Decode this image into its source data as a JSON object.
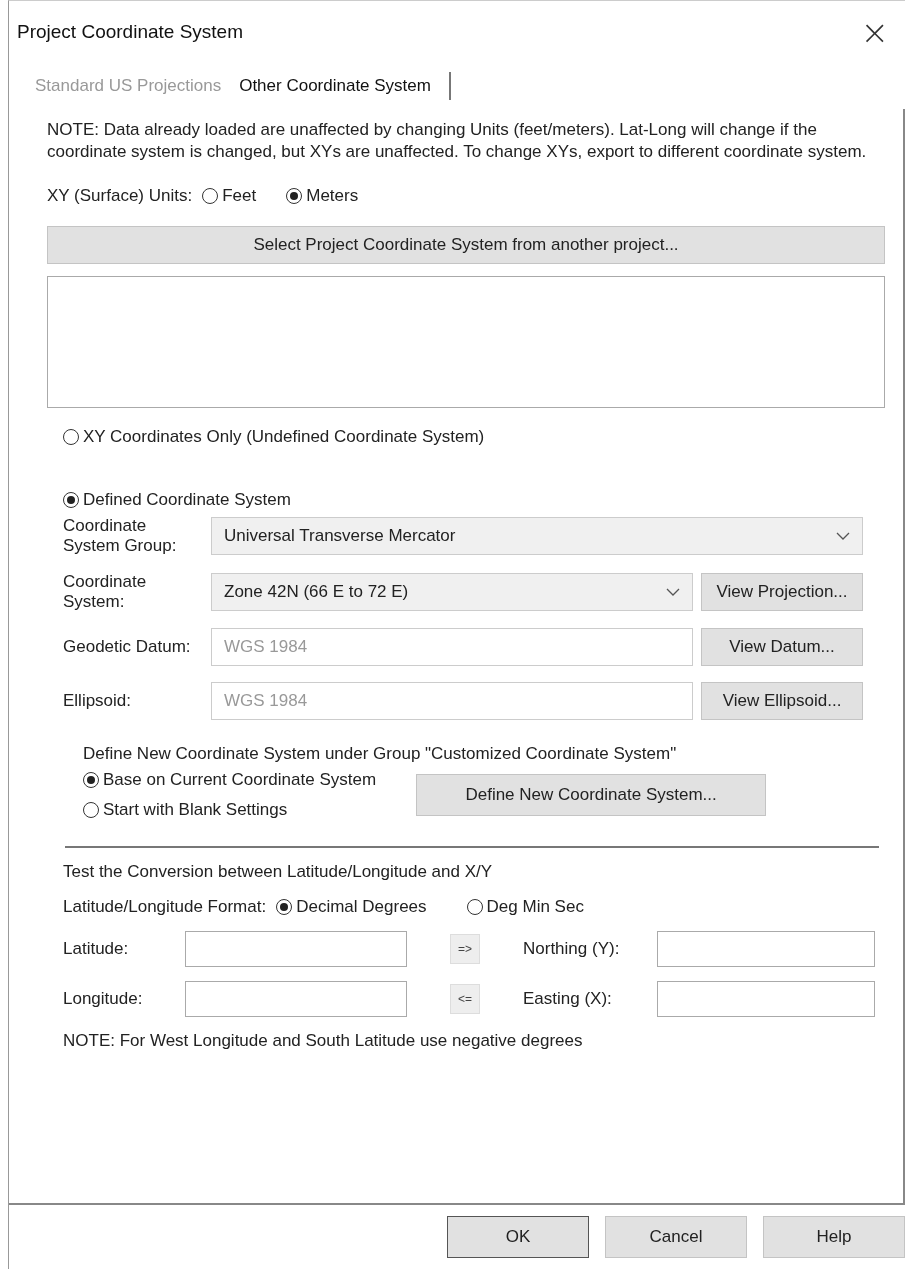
{
  "window": {
    "title": "Project Coordinate System",
    "close": "×"
  },
  "tabs": [
    {
      "label": "Standard US Projections",
      "selected": false
    },
    {
      "label": "Other Coordinate System",
      "selected": true
    }
  ],
  "note": "NOTE: Data already loaded are unaffected by changing Units (feet/meters). Lat-Long will change if the coordinate system is changed, but XYs are unaffected. To change XYs, export to different coordinate system.",
  "units": {
    "label": "XY (Surface) Units:",
    "options": [
      {
        "label": "Feet",
        "selected": false
      },
      {
        "label": "Meters",
        "selected": true
      }
    ]
  },
  "select_button": "Select Project Coordinate System from another project...",
  "system_mode": [
    {
      "label": "XY Coordinates Only (Undefined Coordinate System)",
      "selected": false
    },
    {
      "label": "Defined Coordinate System",
      "selected": true
    }
  ],
  "fields": [
    {
      "kind": "dropdown",
      "label": "Coordinate System Group:",
      "value": "Universal Transverse Mercator",
      "disabled": false
    },
    {
      "kind": "dropdown",
      "label": "Coordinate System:",
      "value": "Zone 42N (66 E to 72 E)",
      "disabled": false,
      "button": "View Projection..."
    },
    {
      "kind": "text",
      "label": "Geodetic Datum:",
      "value": "WGS 1984",
      "disabled": true,
      "button": "View Datum..."
    },
    {
      "kind": "text",
      "label": "Ellipsoid:",
      "value": "WGS 1984",
      "disabled": true,
      "button": "View Ellipsoid..."
    }
  ],
  "define": {
    "label": "Define New Coordinate System under Group \"Customized Coordinate System\"",
    "options": [
      {
        "label": "Base on Current Coordinate System",
        "selected": true
      },
      {
        "label": "Start with Blank Settings",
        "selected": false
      }
    ],
    "button": "Define New Coordinate System..."
  },
  "test": {
    "title": "Test the Conversion between Latitude/Longitude and X/Y",
    "format_label": "Latitude/Longitude Format:",
    "formats": [
      {
        "label": "Decimal Degrees",
        "selected": true
      },
      {
        "label": "Deg Min Sec",
        "selected": false
      }
    ],
    "rows": [
      {
        "left_label": "Latitude:",
        "arrow": "=>",
        "right_label": "Northing (Y):"
      },
      {
        "left_label": "Longitude:",
        "arrow": "<=",
        "right_label": "Easting (X):"
      }
    ],
    "note": "NOTE: For West Longitude and South Latitude use negative degrees"
  },
  "buttons": [
    {
      "label": "OK",
      "default": true
    },
    {
      "label": "Cancel",
      "default": false
    },
    {
      "label": "Help",
      "default": false
    }
  ]
}
